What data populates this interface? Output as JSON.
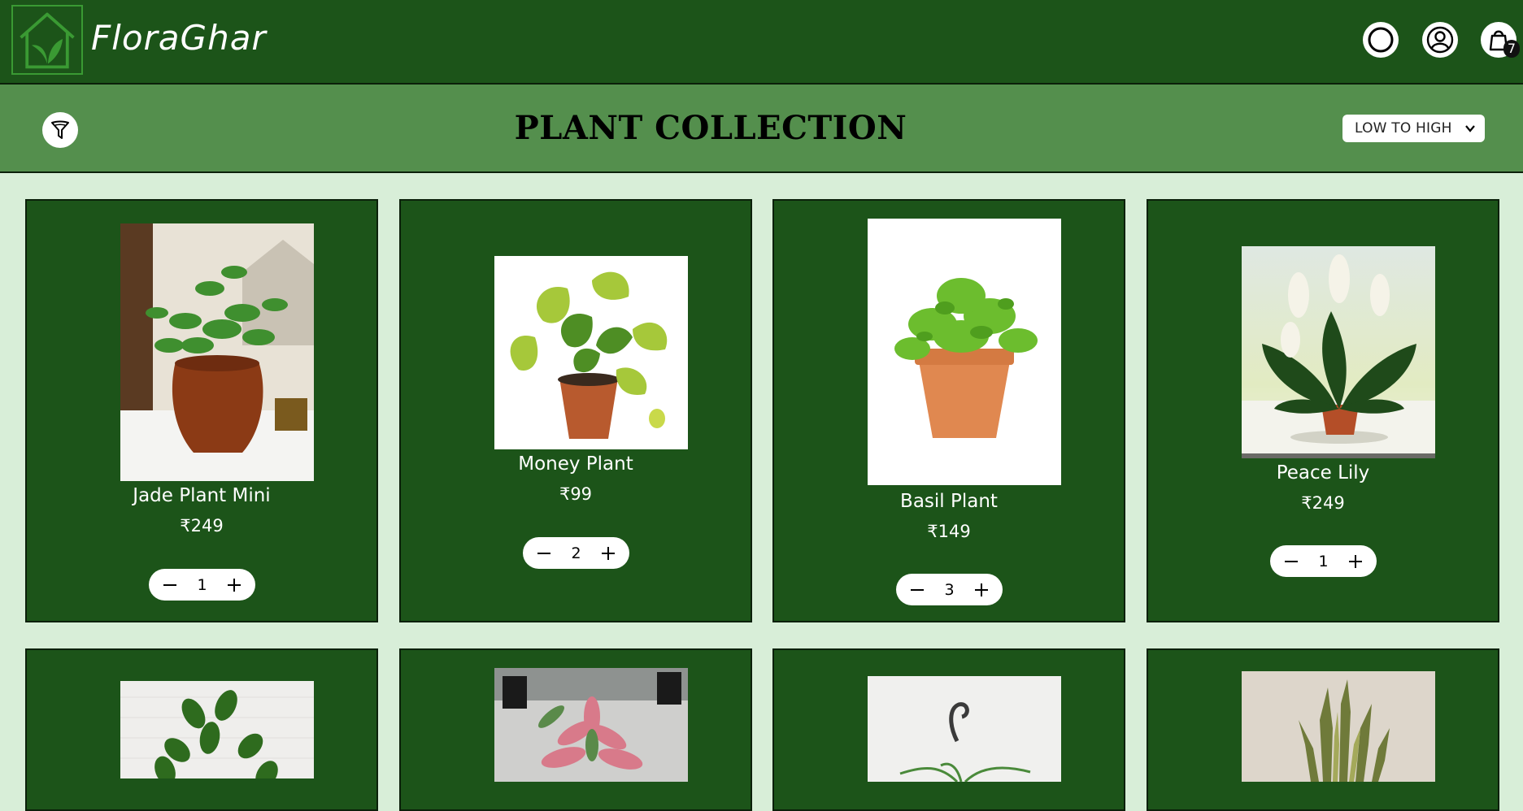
{
  "header": {
    "brand": "FloraGhar",
    "cart_count": "7"
  },
  "subheader": {
    "title": "PLANT COLLECTION",
    "sort_selected": "LOW TO HIGH"
  },
  "products": [
    {
      "name": "Jade Plant Mini",
      "price": "₹249",
      "qty": "1"
    },
    {
      "name": "Money Plant",
      "price": "₹99",
      "qty": "2"
    },
    {
      "name": "Basil Plant",
      "price": "₹149",
      "qty": "3"
    },
    {
      "name": "Peace Lily",
      "price": "₹249",
      "qty": "1"
    }
  ],
  "icons": {
    "logo": "house-leaf-logo-icon",
    "search": "search-icon",
    "account": "user-icon",
    "cart": "shopping-bag-icon",
    "filter": "filter-icon",
    "sort": "chevron-down-icon",
    "minus": "minus-icon",
    "plus": "plus-icon"
  },
  "colors": {
    "header_bg": "#1c5419",
    "subheader_bg": "#548f4d",
    "page_bg": "#d8eed8",
    "card_bg": "#1c5419"
  }
}
